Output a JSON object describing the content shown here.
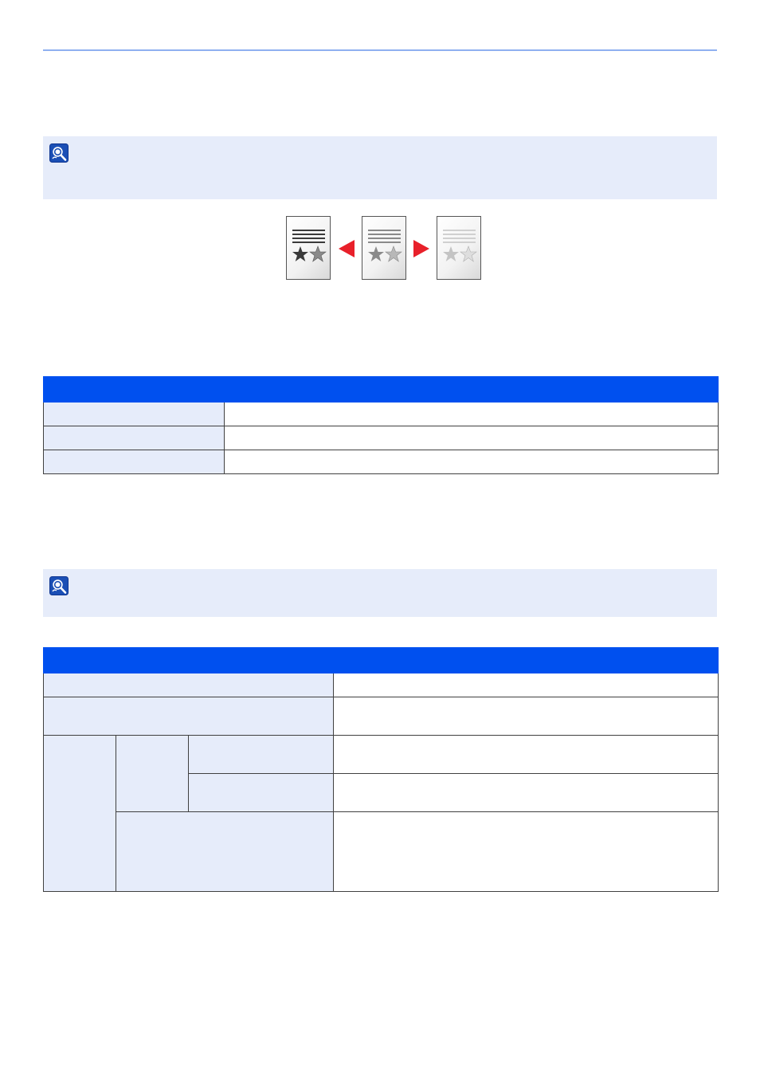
{
  "page": {
    "accent_color": "#0050ef",
    "note_background": "#e6ecfa",
    "rule_color": "#8fb0f0"
  },
  "notes": [
    {
      "icon": "note-icon"
    },
    {
      "icon": "note-icon"
    }
  ],
  "illustration": {
    "documents": [
      "dark-document-icon",
      "normal-document-icon",
      "light-document-icon"
    ],
    "arrows": [
      "left-arrow-icon",
      "right-arrow-icon"
    ],
    "arrow_color": "#e8202a"
  },
  "table1": {
    "headers": [
      "",
      ""
    ],
    "rows": [
      [
        "",
        ""
      ],
      [
        "",
        ""
      ],
      [
        "",
        ""
      ]
    ]
  },
  "table2": {
    "headers": [
      "",
      ""
    ]
  }
}
